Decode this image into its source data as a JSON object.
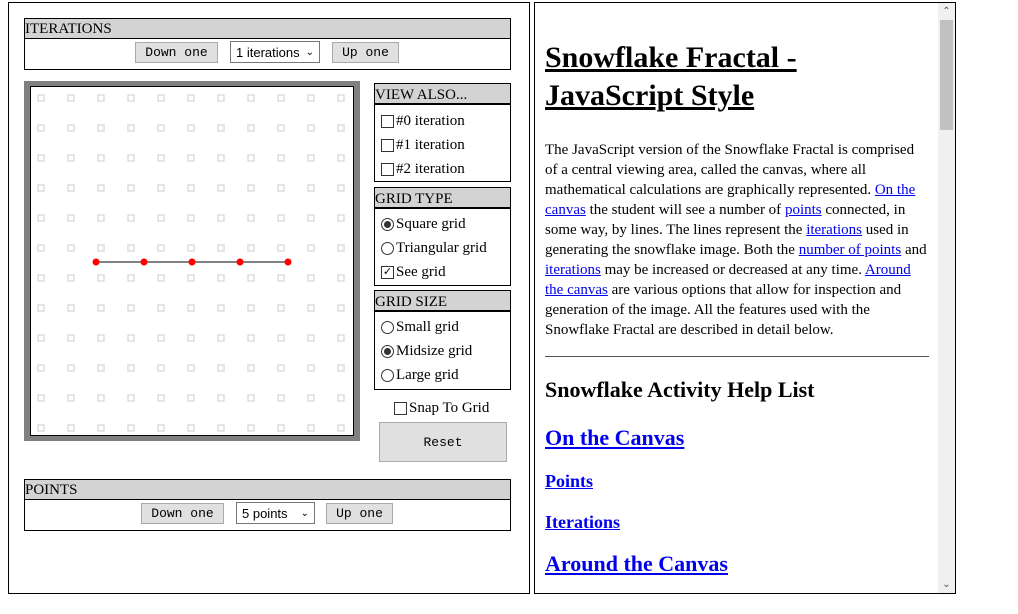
{
  "iterations": {
    "header": "ITERATIONS",
    "down": "Down one",
    "select": "1 iterations",
    "up": "Up one"
  },
  "points": {
    "header": "POINTS",
    "down": "Down one",
    "select": "5 points",
    "up": "Up one"
  },
  "view_also": {
    "header": "VIEW ALSO...",
    "items": [
      {
        "label": "#0 iteration",
        "checked": false
      },
      {
        "label": "#1 iteration",
        "checked": false
      },
      {
        "label": "#2 iteration",
        "checked": false
      }
    ]
  },
  "grid_type": {
    "header": "GRID TYPE",
    "items": [
      {
        "label": "Square grid",
        "selected": true
      },
      {
        "label": "Triangular grid",
        "selected": false
      }
    ],
    "see_grid": {
      "label": "See grid",
      "checked": true
    }
  },
  "grid_size": {
    "header": "GRID SIZE",
    "items": [
      {
        "label": "Small grid",
        "selected": false
      },
      {
        "label": "Midsize grid",
        "selected": true
      },
      {
        "label": "Large grid",
        "selected": false
      }
    ]
  },
  "snap": {
    "label": "Snap To Grid",
    "checked": false
  },
  "reset": "Reset",
  "canvas": {
    "point_color": "#ff0000",
    "points": 5
  },
  "help": {
    "title": "Snowflake Fractal - JavaScript Style",
    "paragraph": [
      {
        "t": "The JavaScript version of the Snowflake Fractal is comprised of a central viewing area, called the canvas, where all mathematical calculations are graphically represented. "
      },
      {
        "t": "On the canvas",
        "link": true
      },
      {
        "t": " the student will see a number of "
      },
      {
        "t": "points",
        "link": true
      },
      {
        "t": " connected, in some way, by lines. The lines represent the "
      },
      {
        "t": "iterations",
        "link": true
      },
      {
        "t": " used in generating the snowflake image. Both the "
      },
      {
        "t": "number of points",
        "link": true
      },
      {
        "t": " and "
      },
      {
        "t": "iterations",
        "link": true
      },
      {
        "t": " may be increased or decreased at any time. "
      },
      {
        "t": "Around the canvas",
        "link": true
      },
      {
        "t": " are various options that allow for inspection and generation of the image. All the features used with the Snowflake Fractal are described in detail below."
      }
    ],
    "list_title": "Snowflake Activity Help List",
    "links": [
      "On the Canvas",
      "Points",
      "Iterations",
      "Around the Canvas"
    ]
  }
}
